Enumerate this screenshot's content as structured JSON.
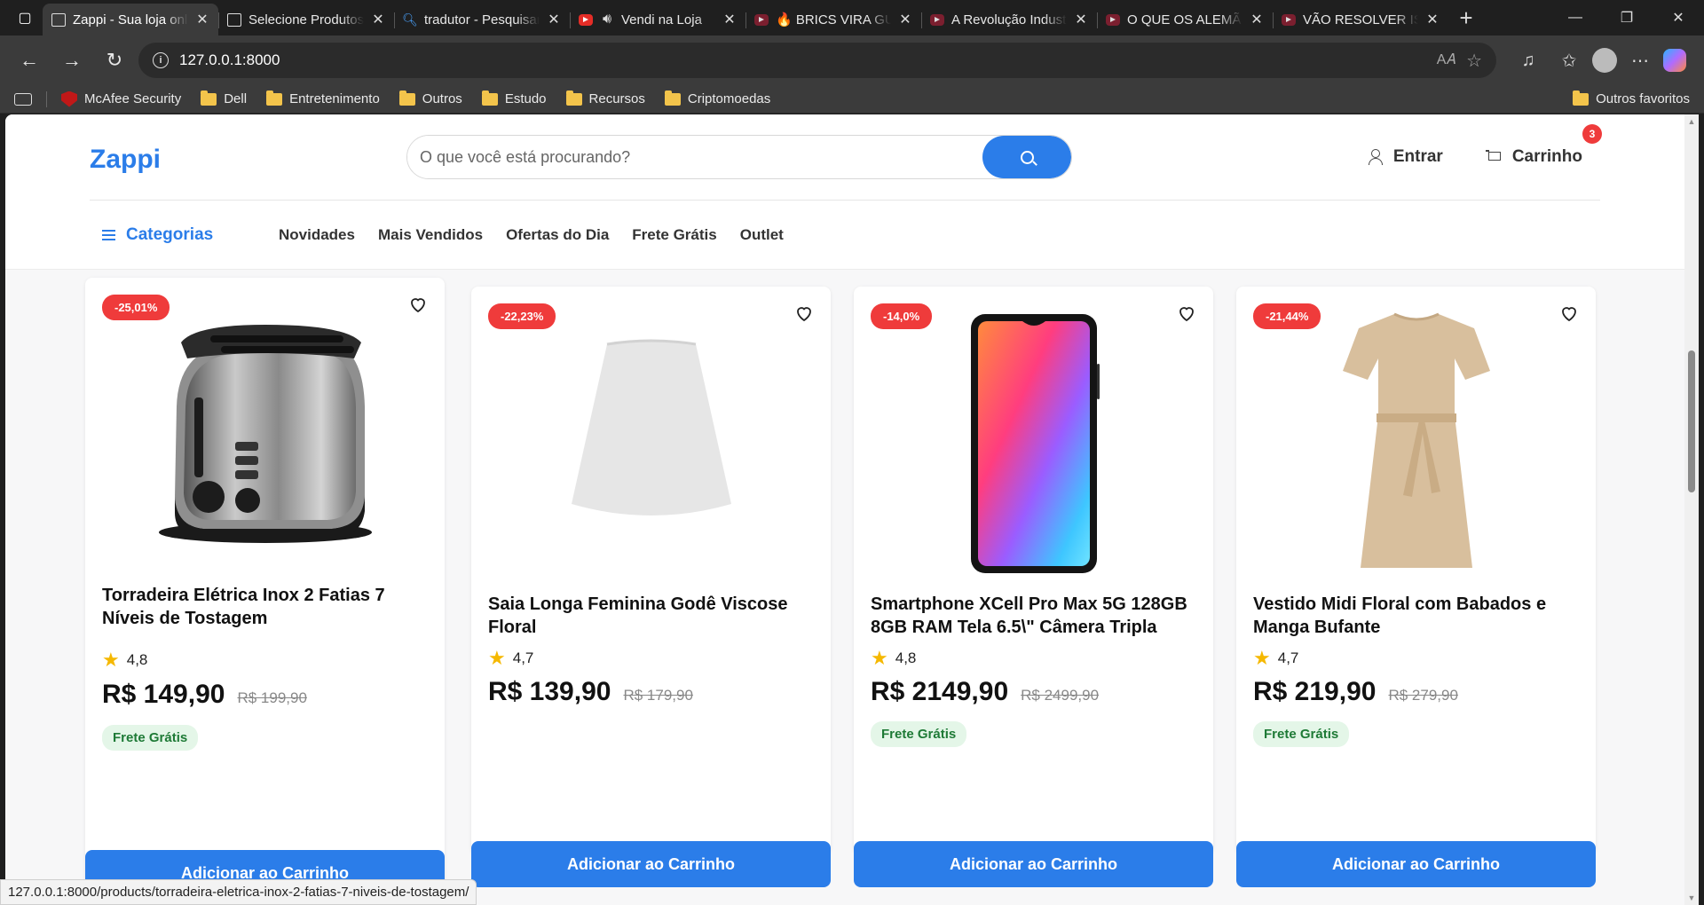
{
  "browser": {
    "tabs": [
      {
        "title": "Zappi - Sua loja online",
        "favicon": "page-icon",
        "active": true
      },
      {
        "title": "Selecione Produtos",
        "favicon": "page-icon",
        "active": false
      },
      {
        "title": "tradutor - Pesquisar",
        "favicon": "search-icon",
        "active": false
      },
      {
        "title": "Vendi na Loja",
        "favicon": "youtube-icon",
        "active": false,
        "audio": true
      },
      {
        "title": "🔥 BRICS VIRA GUERRA",
        "favicon": "youtube-icon",
        "active": false
      },
      {
        "title": "A Revolução Industrial",
        "favicon": "youtube-icon",
        "active": false
      },
      {
        "title": "O QUE OS ALEMÃES",
        "favicon": "youtube-icon",
        "active": false
      },
      {
        "title": "VÃO RESOLVER ISSO",
        "favicon": "youtube-icon",
        "active": false
      }
    ],
    "address": "127.0.0.1:8000",
    "bookmarks": [
      {
        "label": "McAfee Security",
        "icon": "mcafee-icon"
      },
      {
        "label": "Dell",
        "icon": "folder-icon"
      },
      {
        "label": "Entretenimento",
        "icon": "folder-icon"
      },
      {
        "label": "Outros",
        "icon": "folder-icon"
      },
      {
        "label": "Estudo",
        "icon": "folder-icon"
      },
      {
        "label": "Recursos",
        "icon": "folder-icon"
      },
      {
        "label": "Criptomoedas",
        "icon": "folder-icon"
      }
    ],
    "other_favorites": "Outros favoritos",
    "status_url": "127.0.0.1:8000/products/torradeira-eletrica-inox-2-fatias-7-niveis-de-tostagem/"
  },
  "site": {
    "logo": "Zappi",
    "search_placeholder": "O que você está procurando?",
    "login_label": "Entrar",
    "cart_label": "Carrinho",
    "cart_count": "3",
    "categories_label": "Categorias",
    "nav_links": [
      "Novidades",
      "Mais Vendidos",
      "Ofertas do Dia",
      "Frete Grátis",
      "Outlet"
    ],
    "accent_color": "#2b7de9",
    "discount_color": "#ef3b3b"
  },
  "products": [
    {
      "discount": "-25,01%",
      "title": "Torradeira Elétrica Inox 2 Fatias 7 Níveis de Tostagem",
      "rating": "4,8",
      "price": "R$ 149,90",
      "old_price": "R$ 199,90",
      "shipping": "Frete Grátis",
      "button": "Adicionar ao Carrinho",
      "image": "toaster-image"
    },
    {
      "discount": "-22,23%",
      "title": "Saia Longa Feminina Godê Viscose Floral",
      "rating": "4,7",
      "price": "R$ 139,90",
      "old_price": "R$ 179,90",
      "shipping": "",
      "button": "Adicionar ao Carrinho",
      "image": "skirt-image"
    },
    {
      "discount": "-14,0%",
      "title": "Smartphone XCell Pro Max 5G 128GB 8GB RAM Tela 6.5\\\" Câmera Tripla",
      "rating": "4,8",
      "price": "R$ 2149,90",
      "old_price": "R$ 2499,90",
      "shipping": "Frete Grátis",
      "button": "Adicionar ao Carrinho",
      "image": "smartphone-image"
    },
    {
      "discount": "-21,44%",
      "title": "Vestido Midi Floral com Babados e Manga Bufante",
      "rating": "4,7",
      "price": "R$ 219,90",
      "old_price": "R$ 279,90",
      "shipping": "Frete Grátis",
      "button": "Adicionar ao Carrinho",
      "image": "dress-image"
    }
  ]
}
